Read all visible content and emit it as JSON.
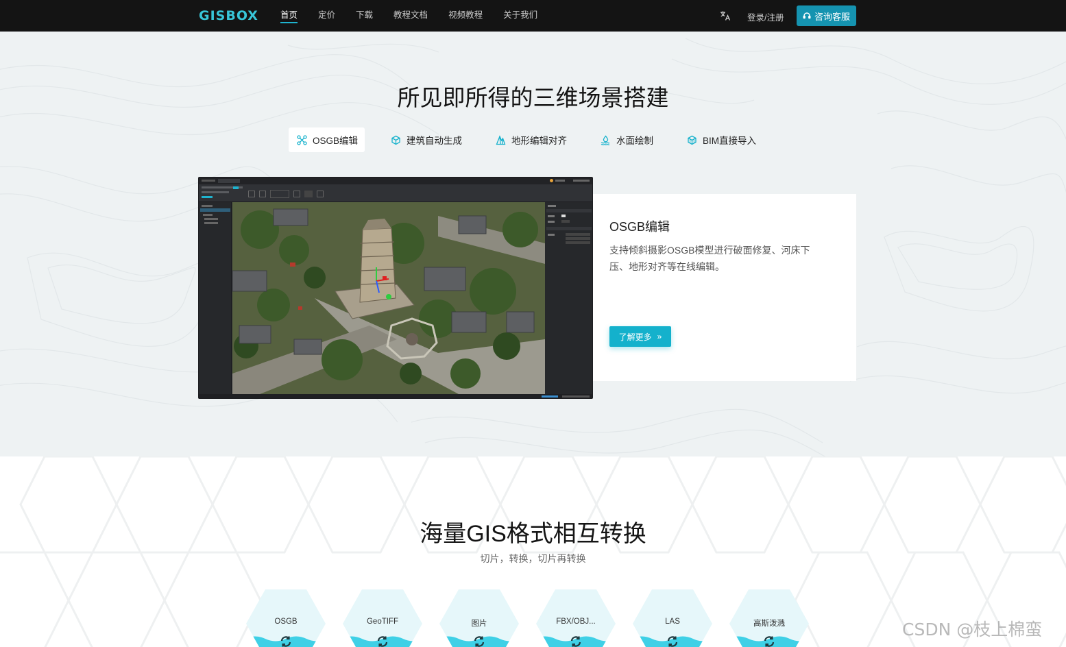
{
  "nav": {
    "logo": "GISBOX",
    "links": [
      "首页",
      "定价",
      "下载",
      "教程文档",
      "视频教程",
      "关于我们"
    ],
    "active_index": 0,
    "lang_icon": "translate-icon",
    "login": "登录/注册",
    "consult": "咨询客服"
  },
  "section1": {
    "title": "所见即所得的三维场景搭建",
    "tabs": [
      {
        "label": "OSGB编辑",
        "icon": "drone-icon"
      },
      {
        "label": "建筑自动生成",
        "icon": "cube-icon"
      },
      {
        "label": "地形编辑对齐",
        "icon": "terrain-icon"
      },
      {
        "label": "水面绘制",
        "icon": "water-icon"
      },
      {
        "label": "BIM直接导入",
        "icon": "bim-cube-icon"
      }
    ],
    "active_tab": 0,
    "card": {
      "title": "OSGB编辑",
      "desc": "支持倾斜摄影OSGB模型进行破面修复、河床下压、地形对齐等在线编辑。",
      "button": "了解更多"
    }
  },
  "section2": {
    "title": "海量GIS格式相互转换",
    "subtitle": "切片，转换，切片再转换",
    "formats": [
      "OSGB",
      "GeoTIFF",
      "图片",
      "FBX/OBJ...",
      "LAS",
      "高斯泼溅"
    ]
  },
  "watermark": "CSDN @枝上棉蛮",
  "colors": {
    "accent": "#14b1cc",
    "nav_bg": "#141414",
    "logo": "#38c6d9",
    "wave": "#3fd0e6"
  }
}
